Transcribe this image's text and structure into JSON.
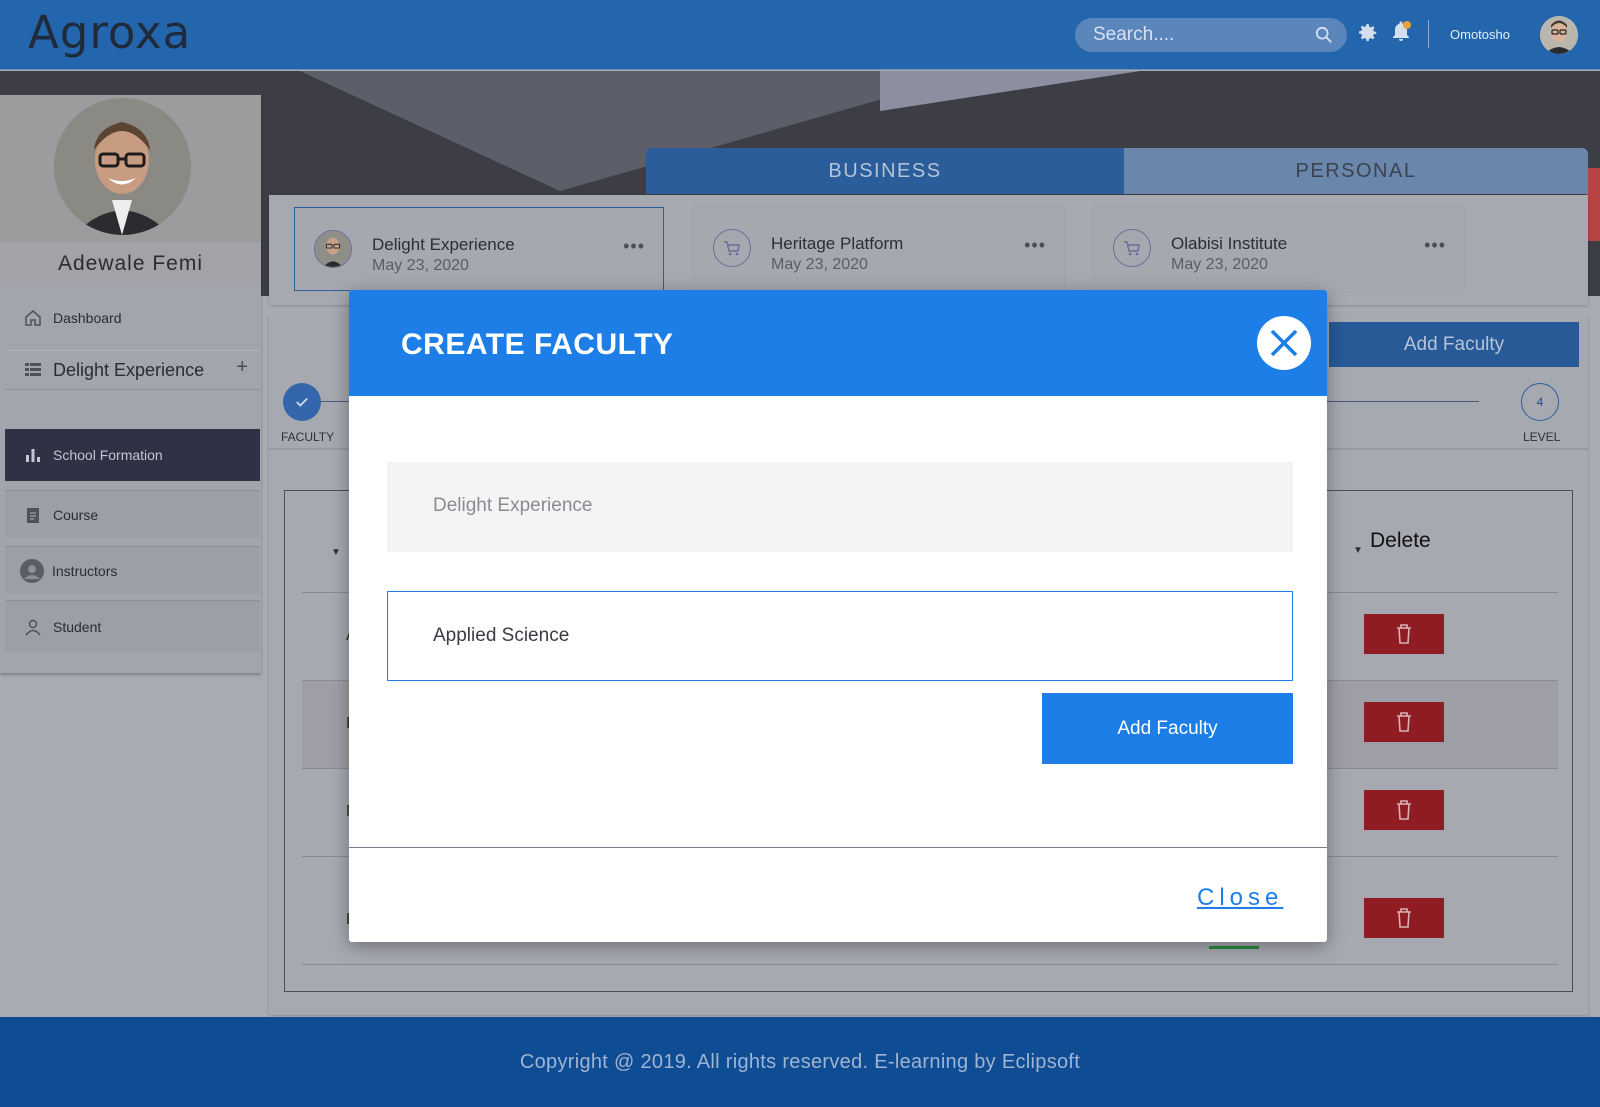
{
  "header": {
    "logo": "Agroxa",
    "search_placeholder": "Search....",
    "username": "Omotosho"
  },
  "tabs": [
    {
      "label": "BUSINESS"
    },
    {
      "label": "PERSONAL"
    }
  ],
  "sidebar": {
    "profile_name": "Adewale Femi",
    "items": [
      {
        "label": "Dashboard",
        "icon": "home-icon"
      },
      {
        "label": "Delight Experience",
        "icon": "list-icon",
        "action": "+"
      },
      {
        "label": "School Formation",
        "icon": "bar-chart-icon",
        "active": true
      },
      {
        "label": "Course",
        "icon": "document-icon"
      },
      {
        "label": "Instructors",
        "icon": "avatar-icon"
      },
      {
        "label": "Student",
        "icon": "user-icon"
      }
    ]
  },
  "cards": [
    {
      "title": "Delight Experience",
      "date": "May 23, 2020",
      "icon": "avatar-icon"
    },
    {
      "title": "Heritage Platform",
      "date": "May 23, 2020",
      "icon": "cart-icon"
    },
    {
      "title": "Olabisi Institute",
      "date": "May 23, 2020",
      "icon": "cart-icon"
    }
  ],
  "main": {
    "add_button": "Add Faculty",
    "steps": [
      {
        "label": "FACULTY",
        "done": true
      },
      {
        "label": "LEVEL",
        "number": "4"
      }
    ],
    "table": {
      "delete_header": "Delete",
      "rows": [
        {
          "letter": "A"
        },
        {
          "letter": "E"
        },
        {
          "letter": "N"
        },
        {
          "letter": "L"
        }
      ]
    }
  },
  "modal": {
    "title": "CREATE FACULTY",
    "readonly_value": "Delight Experience",
    "input_value": "Applied Science",
    "submit_label": "Add Faculty",
    "close_label": "Close"
  },
  "footer": {
    "text": "Copyright @ 2019. All rights reserved. E-learning by Eclipsoft"
  },
  "colors": {
    "primary_blue": "#1c7ee6",
    "header_blue": "#2466ad",
    "footer_blue": "#0e4c94",
    "delete_red": "#8e1c22",
    "sidebar_active": "#2f3144"
  }
}
